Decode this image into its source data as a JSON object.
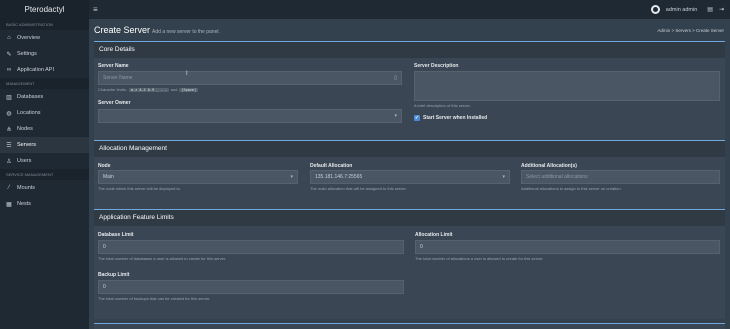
{
  "app": {
    "brand": "Pterodactyl",
    "menu_icon": "≡",
    "user": "admin admin"
  },
  "sidebar": {
    "sections": [
      {
        "header": "BASIC ADMINISTRATION",
        "items": [
          {
            "label": "Overview",
            "icon": "home-icon"
          },
          {
            "label": "Settings",
            "icon": "wrench-icon"
          },
          {
            "label": "Application API",
            "icon": "link-icon"
          }
        ]
      },
      {
        "header": "MANAGEMENT",
        "items": [
          {
            "label": "Databases",
            "icon": "database-icon"
          },
          {
            "label": "Locations",
            "icon": "globe-icon"
          },
          {
            "label": "Nodes",
            "icon": "sitemap-icon"
          },
          {
            "label": "Servers",
            "icon": "server-icon",
            "active": true
          },
          {
            "label": "Users",
            "icon": "users-icon"
          }
        ]
      },
      {
        "header": "SERVICE MANAGEMENT",
        "items": [
          {
            "label": "Mounts",
            "icon": "magic-icon"
          },
          {
            "label": "Nests",
            "icon": "th-large-icon"
          }
        ]
      }
    ]
  },
  "page": {
    "title": "Create Server",
    "subtitle": "Add a new server to the panel.",
    "breadcrumb": [
      "Admin",
      "Servers",
      "Create Server"
    ]
  },
  "core": {
    "title": "Core Details",
    "server_name_label": "Server Name",
    "server_name_placeholder": "Server Name",
    "char_limits_text": "Character limits:",
    "char_codes": [
      "a-z A-Z 0-9 _ - .",
      "[Space]"
    ],
    "char_and": "and",
    "server_owner_label": "Server Owner",
    "desc_label": "Server Description",
    "desc_help": "A brief description of this server.",
    "start_label": "Start Server when Installed",
    "start_checked": true
  },
  "allocation": {
    "title": "Allocation Management",
    "node_label": "Node",
    "node_value": "Main",
    "node_help": "The node which this server will be deployed to.",
    "default_label": "Default Allocation",
    "default_value": "135.181.146.7:25565",
    "default_help": "The main allocation that will be assigned to this server.",
    "additional_label": "Additional Allocation(s)",
    "additional_placeholder": "Select additional allocations",
    "additional_help": "Additional allocations to assign to this server on creation."
  },
  "features": {
    "title": "Application Feature Limits",
    "db_label": "Database Limit",
    "db_value": "0",
    "db_help": "The total number of databases a user is allowed to create for this server.",
    "alloc_label": "Allocation Limit",
    "alloc_value": "0",
    "alloc_help": "The total number of allocations a user is allowed to create for this server.",
    "backup_label": "Backup Limit",
    "backup_value": "0",
    "backup_help": "The total number of backups that can be created for this server."
  }
}
